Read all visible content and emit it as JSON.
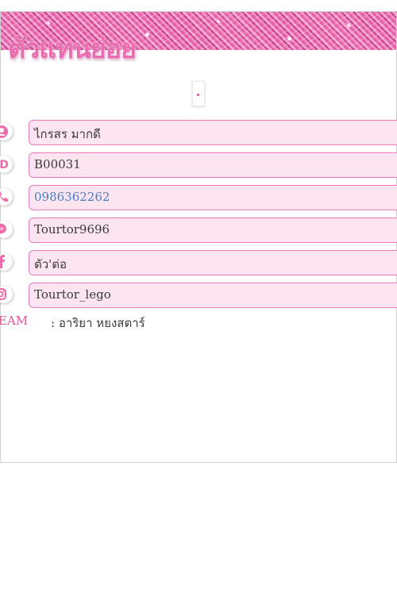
{
  "brand": {
    "title": "ตัวแทนย่อย"
  },
  "profile": {
    "name": "ไกรสร  มากดี",
    "member_id": "B00031",
    "phone": "0986362262",
    "line_id": "Tourtor9696",
    "facebook": "ตัว'ต่อ",
    "instagram": "Tourtor_lego"
  },
  "team": {
    "label": "TEAM",
    "value": ": อาริยา หยงสตาร์"
  },
  "icons": [
    "user-icon",
    "id-icon",
    "phone-icon",
    "line-icon",
    "facebook-icon",
    "instagram-icon"
  ],
  "colors": {
    "accent": "#e8559d",
    "field_bg": "#fce4f0",
    "field_border": "#e97cb6",
    "link": "#4a7fc4"
  }
}
